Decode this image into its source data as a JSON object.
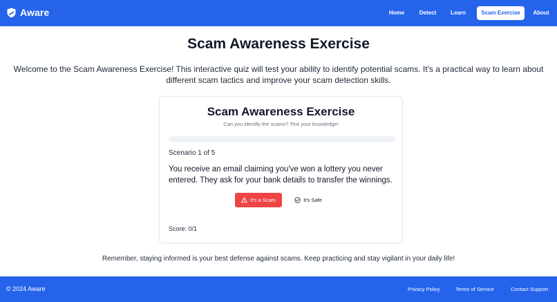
{
  "brand": {
    "name": "Aware",
    "icon": "shield-icon"
  },
  "nav": {
    "items": [
      {
        "label": "Home",
        "active": false
      },
      {
        "label": "Detect",
        "active": false
      },
      {
        "label": "Learn",
        "active": false
      },
      {
        "label": "Scam Exercise",
        "active": true
      },
      {
        "label": "About",
        "active": false
      }
    ]
  },
  "page": {
    "title": "Scam Awareness Exercise",
    "intro": "Welcome to the Scam Awareness Exercise! This interactive quiz will test your ability to identify potential scams. It's a practical way to learn about different scam tactics and improve your scam detection skills."
  },
  "quiz": {
    "title": "Scam Awareness Exercise",
    "subtitle": "Can you identify the scams? Test your knowledge!",
    "progress": 0,
    "scenario_label": "Scenario 1 of 5",
    "scenario_text": "You receive an email claiming you've won a lottery you never entered. They ask for your bank details to transfer the winnings.",
    "scam_button": {
      "label": "It's a Scam",
      "icon": "warning-triangle-icon"
    },
    "safe_button": {
      "label": "It's Safe",
      "icon": "check-circle-icon"
    },
    "score": "Score: 0/1"
  },
  "reminder": "Remember, staying informed is your best defense against scams. Keep practicing and stay vigilant in your daily life!",
  "footer": {
    "copyright": "© 2024 Aware",
    "links": [
      "Privacy Policy",
      "Terms of Service",
      "Contact Support"
    ]
  },
  "colors": {
    "primary": "#2563eb",
    "danger": "#ef4444",
    "progress_track": "#eef2f7"
  }
}
